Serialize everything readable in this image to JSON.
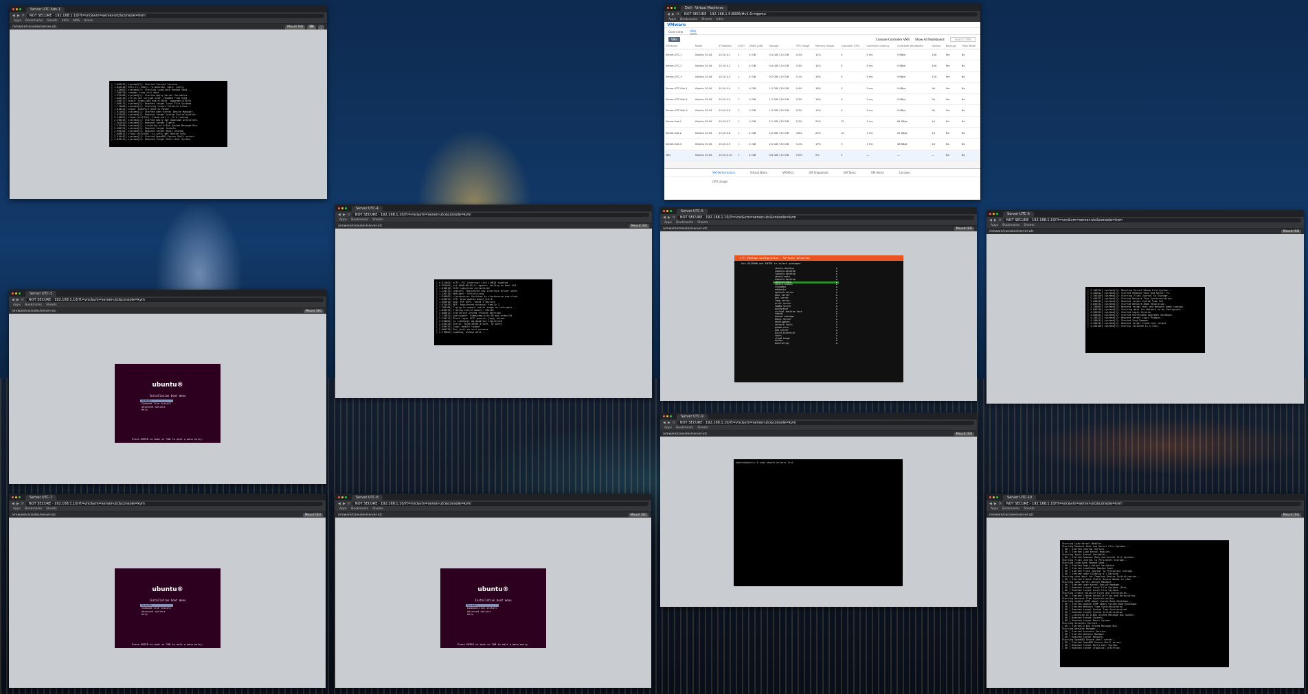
{
  "console_window": {
    "tab_title": "Server UTC-Sdn-1",
    "url": "NOT SECURE · 192.168.1.10/?t=vnc&vm=server-utc&console=kvm",
    "bookmarks": [
      "Apps",
      "Bookmarks",
      "Sheets",
      "Infra",
      "AWS",
      "Azure",
      "Google Flights",
      "Portfolio",
      "Cloud",
      "Drive"
    ],
    "console_path": "/vmware/consoles/server-utc",
    "actions": [
      "Mount ISO",
      "Keyboard",
      "Fullscreen",
      "Reload"
    ]
  },
  "tabs": {
    "w1": "Server UTC-Sdn-1",
    "w2": "Server UTC-Sdn-2",
    "w3": "Server UTC-3",
    "w4": "Server UTC-4",
    "w5": "Server UTC-5",
    "w6": "Server UTC-6",
    "w7": "Server UTC-7",
    "w8": "Server UTC-8",
    "w9": "Server UTC-9",
    "w10": "Server UTC-10"
  },
  "terminal_top_left": [
    "[    1.002012] systemd[1]: Started Journal Service.",
    "[    1.042218] EXT4-fs (vda1): re-mounted. Opts: (null)",
    "[    1.120003] systemd[1]: Starting Load/Save Random Seed...",
    "[    1.200110] random: crng init done",
    "[    1.331100] systemd[1]: Started Apply Kernel Variables.",
    "[    1.402113] virtio_net virtio0 ens3: renamed from eth0",
    "[    1.500217] audit: type=1400 audit(1640): apparmor=STATUS",
    "[    1.600112] systemd[1]: Reached target Local File Systems.",
    "[    1.711000] systemd[1]: Starting Create Volatile Files...",
    "[    1.810321] input: ImExPS/2 Generic Mouse",
    "[    1.921002] systemd[1]: Started udev Kernel Device Manager.",
    "[    2.031003] systemd[1]: Reached target System Initialization.",
    "[    2.140021] cloud-init[512]: Cloud-init v. 21.4 running",
    "[    2.250333] systemd[1]: Started Daily apt download activities.",
    "[    2.361010] systemd[1]: Reached target Timers.",
    "[    2.470100] systemd[1]: Listening on D-Bus System Message Bus.",
    "[    2.580224] systemd[1]: Reached target Sockets.",
    "[    2.690102] systemd[1]: Reached target Basic System.",
    "[    2.800011] cloud-init[640]: ci-info: Net device info",
    "[    2.910442] systemd[1]: Started OpenBSD Secure Shell server.",
    "[    3.020111] systemd[1]: Reached target Multi-User System."
  ],
  "terminal_mid": [
    "[    0.812002] ACPI: PCI Interrupt Link [LNKD] enabled",
    "[    0.901001] pci 0000:00:02.0: vgaarb: setting as boot VGA",
    "[    1.010010] SCSI subsystem initialized",
    "[    1.120331] usbcore: registered new interface driver usbfs",
    "[    1.230110] NetLabel: Initializing",
    "[    1.340002] clocksource: Switched to clocksource kvm-clock",
    "[    1.450221] VFS: Disk quotas dquot_6.6.0",
    "[    1.560010] pnp: PnP ACPI: found 5 devices",
    "[    1.670443] NET: Registered protocol family 2",
    "[    1.780100] Trying to unpack rootfs image as initramfs...",
    "[    1.890333] Freeing initrd memory: 61212K",
    "[    2.000012] Initialise system trusted keyrings",
    "[    2.110021] workingset: timestamp_bits=36 max_order=20",
    "[    2.220311] Block layer SCSI generic (bsg) driver",
    "[    2.330001] io scheduler mq-deadline registered",
    "[    2.440120] Serial: 8250/16550 driver, 32 ports",
    "[    2.550331] loop: module loaded",
    "[    2.660210] Run /init as init process",
    "[    2.770001] Loading, please wait..."
  ],
  "terminal_right": [
    "[    3.100212] systemd[1]: Mounting Kernel Debug File System...",
    "[    3.200012] systemd[1]: Started Remount Root and Kernel FS.",
    "[    3.300100] systemd[1]: Starting Flush Journal to Storage...",
    "[    3.400221] systemd[1]: Started Network Time Synchronization.",
    "[    3.500012] systemd[1]: Reached target System Time Set.",
    "[    3.600331] systemd[1]: Started Network Name Resolution.",
    "[    3.700003] systemd[1]: Reached target Host and Network Name Lookups.",
    "[    3.800120] systemd[1]: Starting Wait for Network to be Configured...",
    "[    3.900222] systemd[1]: Started Login Service.",
    "[    4.000041] systemd[1]: Started Unattended Upgrades Shutdown.",
    "[    4.100222] systemd[1]: Reached target Login Prompts.",
    "[    4.200013] systemd[1]: Started Snap Daemon.",
    "[    4.300331] systemd[1]: Reached target Cloud-init target.",
    "[    4.400100] systemd[1]: Startup finished in 4.312s."
  ],
  "terminal_shell": "ubuntu@ubuntu:~$ sudo ubuntu-drivers list",
  "terminal_bottom_right": [
    "  Starting Load Kernel Modules...",
    "  Starting Remount Root and Kernel File Systems...",
    "[  OK  ] Started Journal Service.",
    "[  OK  ] Started Load Kernel Modules.",
    "  Starting Apply Kernel Variables...",
    "[  OK  ] Started Remount Root and Kernel File Systems.",
    "  Starting Flush Journal to Persistent Storage...",
    "  Starting Load/Save Random Seed...",
    "[  OK  ] Started Apply Kernel Variables.",
    "[  OK  ] Started Load/Save Random Seed.",
    "[  OK  ] Started Flush Journal to Persistent Storage.",
    "[  OK  ] Started udev Coldplug all Devices.",
    "  Starting udev Wait for Complete Device Initialization...",
    "[  OK  ] Started Create Static Device Nodes in /dev.",
    "  Starting udev Kernel Device Manager...",
    "[  OK  ] Started udev Kernel Device Manager.",
    "[  OK  ] Reached target Local File Systems (Pre).",
    "[  OK  ] Reached target Local File Systems.",
    "  Starting Create Volatile Files and Directories...",
    "[  OK  ] Started Create Volatile Files and Directories.",
    "  Starting Network Time Synchronization...",
    "  Starting Update UTMP about System Boot/Shutdown...",
    "[  OK  ] Started Update UTMP about System Boot/Shutdown.",
    "[  OK  ] Started Network Time Synchronization.",
    "[  OK  ] Reached target System Time Synchronized.",
    "[  OK  ] Reached target System Initialization.",
    "[  OK  ] Listening on D-Bus System Message Bus Socket.",
    "[  OK  ] Reached target Sockets.",
    "[  OK  ] Reached target Basic System.",
    "  Starting Accounts Service...",
    "[  OK  ] Started D-Bus System Message Bus.",
    "  Starting Network Manager...",
    "[  OK  ] Started Accounts Service.",
    "[  OK  ] Started Network Manager.",
    "[  OK  ] Reached target Network.",
    "  Starting OpenBSD Secure Shell server...",
    "[  OK  ] Started OpenBSD Secure Shell server.",
    "[  OK  ] Reached target Multi-User System.",
    "[  OK  ] Reached target Graphical Interface."
  ],
  "ubuntu_boot": {
    "logo": "ubuntu®",
    "grub_title": "Installation boot menu",
    "items": [
      "Install",
      "Command-line install",
      "Advanced options",
      "Help"
    ],
    "footer": "Press ENTER to boot or TAB to edit a menu entry."
  },
  "installer": {
    "header": "[!!] Package configuration - Software selection",
    "hint": "Use UP/DOWN and ENTER to select packages",
    "items": [
      "ubuntu-desktop",
      "xubuntu-desktop",
      "lubuntu-desktop",
      "ubuntu-mate",
      "kubuntu-desktop",
      "ubuntustudio",
      "ubuntu-budgie",
      "cinnamon",
      "edubuntu",
      "openssh-server",
      "mail server",
      "dns server",
      "lamp server",
      "print server",
      "samba server",
      "postgresql",
      "virtual machine host",
      "tomcat",
      "manual package",
      "basic server",
      "development",
      "network tools",
      "gnome-core",
      "web server",
      "build-essential",
      "fonts",
      "cloud image",
      "docker",
      "monitoring"
    ],
    "selected_index": 5
  },
  "pve": {
    "tab_title": "Dell - Virtual Machines",
    "url": "NOT SECURE · 192.168.1.5:8006/#v1:0:=qemu",
    "product": "VMware",
    "tabs": [
      "Overview",
      "VMs"
    ],
    "active_tab": "VMs",
    "tool_button": "VMs",
    "filter_label": "Console Controller VM4",
    "filter_value": "Show All Pasteboard",
    "search_placeholder": "Search VMs",
    "columns": [
      "VM Name",
      "Notes",
      "IP Address",
      "vCPU",
      "vRAM (GiB)",
      "Storage",
      "CPU Usage",
      "Memory Usage",
      "Controller IOPS",
      "Controller Latency",
      "Controller Bandwidth",
      "Uptime",
      "Backups",
      "Flash Mode"
    ],
    "rows": [
      [
        "Server-UTC-1",
        "Ubuntu 20.04",
        "10.10.0.1",
        "1",
        "4 GiB",
        "0.4 GiB / 20 GiB",
        "0.2%",
        "12%",
        "0",
        "0 ms",
        "0 KBps",
        "14d",
        "Yes",
        "No"
      ],
      [
        "Server-UTC-2",
        "Ubuntu 20.04",
        "10.10.0.2",
        "1",
        "4 GiB",
        "0.4 GiB / 20 GiB",
        "0.3%",
        "14%",
        "0",
        "0 ms",
        "0 KBps",
        "14d",
        "Yes",
        "No"
      ],
      [
        "Server-UTC-3",
        "Ubuntu 20.04",
        "10.10.0.3",
        "1",
        "4 GiB",
        "0.5 GiB / 20 GiB",
        "0.1%",
        "10%",
        "0",
        "0 ms",
        "0 KBps",
        "12d",
        "Yes",
        "No"
      ],
      [
        "Server-UTC-Sdn-1",
        "Ubuntu 20.04",
        "10.10.0.4",
        "1",
        "4 GiB",
        "1.2 GiB / 20 GiB",
        "0.4%",
        "18%",
        "0",
        "0 ms",
        "0 KBps",
        "9d",
        "Yes",
        "No"
      ],
      [
        "Server-UTC-Sdn-2",
        "Ubuntu 20.04",
        "10.10.0.5",
        "1",
        "4 GiB",
        "1.1 GiB / 20 GiB",
        "0.3%",
        "16%",
        "0",
        "0 ms",
        "0 KBps",
        "9d",
        "Yes",
        "No"
      ],
      [
        "Server-UTC-Sdn-3",
        "Ubuntu 20.04",
        "10.10.0.6",
        "1",
        "4 GiB",
        "1.0 GiB / 20 GiB",
        "0.2%",
        "15%",
        "0",
        "0 ms",
        "0 KBps",
        "9d",
        "Yes",
        "No"
      ],
      [
        "Server-Inst-1",
        "Ubuntu 20.04",
        "10.10.0.7",
        "1",
        "4 GiB",
        "2.1 GiB / 20 GiB",
        "5.2%",
        "22%",
        "12",
        "1 ms",
        "64 KBps",
        "1d",
        "No",
        "No"
      ],
      [
        "Server-Inst-2",
        "Ubuntu 20.04",
        "10.10.0.8",
        "1",
        "4 GiB",
        "2.0 GiB / 20 GiB",
        "4.8%",
        "20%",
        "10",
        "1 ms",
        "52 KBps",
        "1d",
        "No",
        "No"
      ],
      [
        "Server-Inst-3",
        "Ubuntu 20.04",
        "10.10.0.9",
        "1",
        "4 GiB",
        "2.0 GiB / 20 GiB",
        "4.1%",
        "19%",
        "9",
        "1 ms",
        "48 KBps",
        "1d",
        "No",
        "No"
      ],
      [
        "Test",
        "Ubuntu 20.04",
        "10.10.0.10",
        "1",
        "4 GiB",
        "0.8 GiB / 20 GiB",
        "0.0%",
        "0%",
        "0",
        "—",
        "—",
        "—",
        "No",
        "No"
      ]
    ],
    "subtabs": [
      "VM Performance",
      "Virtual Disks",
      "VM NICs",
      "VM Snapshots",
      "VM Tasks",
      "VM Alerts",
      "Console"
    ],
    "perf_label": "CPU Usage"
  }
}
